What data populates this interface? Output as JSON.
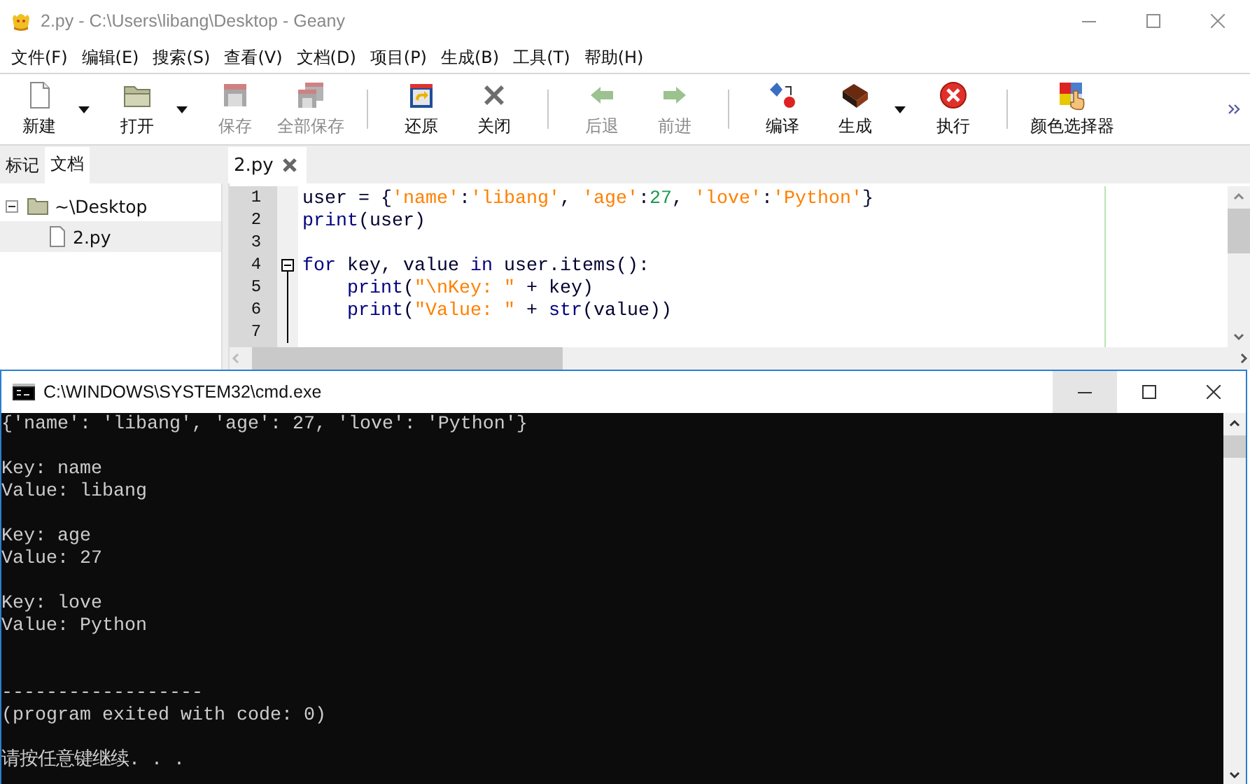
{
  "window": {
    "title": "2.py - C:\\Users\\libang\\Desktop - Geany",
    "buttons": [
      {
        "kind": "minimize",
        "hovered": false
      },
      {
        "kind": "maximize",
        "hovered": false
      },
      {
        "kind": "close",
        "hovered": false
      }
    ]
  },
  "menu": [
    "文件(F)",
    "编辑(E)",
    "搜索(S)",
    "查看(V)",
    "文档(D)",
    "项目(P)",
    "生成(B)",
    "工具(T)",
    "帮助(H)"
  ],
  "toolbar": [
    {
      "kind": "button",
      "label": "新建",
      "disabled": false,
      "dropdown": true
    },
    {
      "kind": "button",
      "label": "打开",
      "disabled": false,
      "dropdown": true
    },
    {
      "kind": "button",
      "label": "保存",
      "disabled": true,
      "dropdown": false
    },
    {
      "kind": "button",
      "label": "全部保存",
      "disabled": true,
      "dropdown": false
    },
    {
      "kind": "separator"
    },
    {
      "kind": "button",
      "label": "还原",
      "disabled": false,
      "dropdown": false
    },
    {
      "kind": "button",
      "label": "关闭",
      "disabled": false,
      "dropdown": false
    },
    {
      "kind": "separator"
    },
    {
      "kind": "button",
      "label": "后退",
      "disabled": true,
      "dropdown": false
    },
    {
      "kind": "button",
      "label": "前进",
      "disabled": true,
      "dropdown": false
    },
    {
      "kind": "separator"
    },
    {
      "kind": "button",
      "label": "编译",
      "disabled": false,
      "dropdown": false
    },
    {
      "kind": "button",
      "label": "生成",
      "disabled": false,
      "dropdown": true
    },
    {
      "kind": "button",
      "label": "执行",
      "disabled": false,
      "dropdown": false
    },
    {
      "kind": "separator"
    },
    {
      "kind": "button",
      "label": "颜色选择器",
      "disabled": false,
      "dropdown": false
    },
    {
      "kind": "overflow"
    }
  ],
  "sidebar": {
    "tabs": [
      {
        "label": "标记",
        "selected": false
      },
      {
        "label": "文档",
        "selected": true
      }
    ],
    "tree": [
      {
        "label": "~\\Desktop",
        "expanded": true,
        "selected": false,
        "children": [
          {
            "label": "2.py",
            "selected": true
          }
        ]
      }
    ]
  },
  "editor": {
    "tabs": [
      {
        "label": "2.py",
        "selected": true
      }
    ],
    "lines": [
      {
        "number": "1",
        "fold": false,
        "segments": [
          {
            "kind": "plain",
            "text": "user = {"
          },
          {
            "kind": "string",
            "text": "'name'"
          },
          {
            "kind": "plain",
            "text": ":"
          },
          {
            "kind": "string",
            "text": "'libang'"
          },
          {
            "kind": "plain",
            "text": ", "
          },
          {
            "kind": "string",
            "text": "'age'"
          },
          {
            "kind": "plain",
            "text": ":"
          },
          {
            "kind": "number",
            "text": "27"
          },
          {
            "kind": "plain",
            "text": ", "
          },
          {
            "kind": "string",
            "text": "'love'"
          },
          {
            "kind": "plain",
            "text": ":"
          },
          {
            "kind": "string",
            "text": "'Python'"
          },
          {
            "kind": "plain",
            "text": "}"
          }
        ]
      },
      {
        "number": "2",
        "fold": false,
        "segments": [
          {
            "kind": "keyword",
            "text": "print"
          },
          {
            "kind": "plain",
            "text": "(user)"
          }
        ]
      },
      {
        "number": "3",
        "fold": false
      },
      {
        "number": "4",
        "fold": true,
        "segments": [
          {
            "kind": "keyword",
            "text": "for"
          },
          {
            "kind": "plain",
            "text": " key, value "
          },
          {
            "kind": "keyword",
            "text": "in"
          },
          {
            "kind": "plain",
            "text": " user.items():"
          }
        ]
      },
      {
        "number": "5",
        "fold": false,
        "indented": true,
        "segments": [
          {
            "kind": "keyword",
            "text": "print"
          },
          {
            "kind": "plain",
            "text": "("
          },
          {
            "kind": "string",
            "text": "\"\\nKey: \""
          },
          {
            "kind": "plain",
            "text": " + key)"
          }
        ]
      },
      {
        "number": "6",
        "fold": false,
        "indented": true,
        "segments": [
          {
            "kind": "keyword",
            "text": "print"
          },
          {
            "kind": "plain",
            "text": "("
          },
          {
            "kind": "string",
            "text": "\"Value: \""
          },
          {
            "kind": "plain",
            "text": " + "
          },
          {
            "kind": "keyword",
            "text": "str"
          },
          {
            "kind": "plain",
            "text": "(value))"
          }
        ]
      },
      {
        "number": "7",
        "fold": false
      }
    ]
  },
  "console": {
    "title": "C:\\WINDOWS\\SYSTEM32\\cmd.exe",
    "buttons": [
      {
        "kind": "minimize",
        "hovered": true
      },
      {
        "kind": "maximize",
        "hovered": false
      },
      {
        "kind": "close",
        "hovered": false
      }
    ],
    "blocks": [
      {
        "wide_gap": false,
        "lines": [
          "{'name': 'libang', 'age': 27, 'love': 'Python'}"
        ]
      },
      {
        "wide_gap": false,
        "lines": [
          "Key: name",
          "Value: libang"
        ]
      },
      {
        "wide_gap": false,
        "lines": [
          "Key: age",
          "Value: 27"
        ]
      },
      {
        "wide_gap": false,
        "lines": [
          "Key: love",
          "Value: Python"
        ]
      },
      {
        "wide_gap": true,
        "lines": [
          "------------------",
          "(program exited with code: 0)"
        ]
      },
      {
        "wide_gap": false,
        "lines": [
          "请按任意键继续. . ."
        ]
      }
    ]
  }
}
